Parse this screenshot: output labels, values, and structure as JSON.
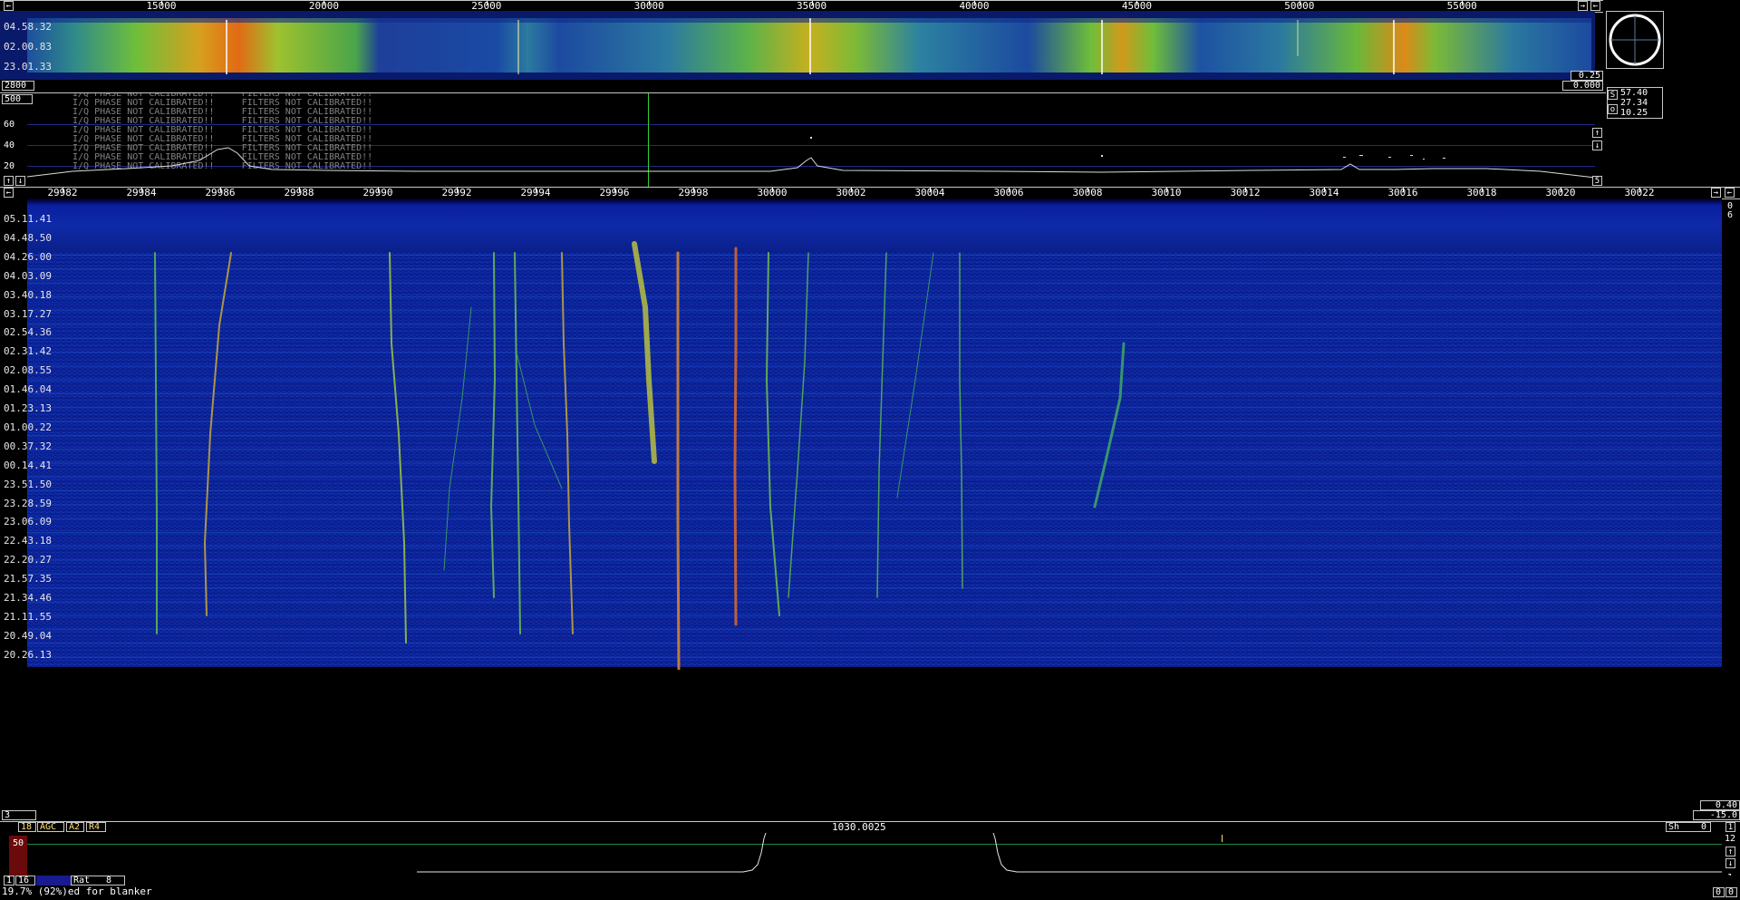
{
  "wide_scale": {
    "labels": [
      "15000",
      "20000",
      "25000",
      "30000",
      "35000",
      "40000",
      "45000",
      "50000",
      "55000"
    ],
    "left_arrow": "←",
    "right_arrow": "→",
    "right_arrow2": "←"
  },
  "wide_waterfall": {
    "time_labels": [
      "04.58.32",
      "02.00.83",
      "23.01.33"
    ],
    "left_value": "2800",
    "right_value_top": "0.25",
    "right_value_bottom": "0.000"
  },
  "spectrum": {
    "top_left_value": "500",
    "db_labels": [
      "60",
      "40",
      "20"
    ],
    "warning_rows": [
      "I/Q PHASE NOT CALIBRATED!!     FILTERS NOT CALIBRATED!!",
      "I/Q PHASE NOT CALIBRATED!!     FILTERS NOT CALIBRATED!!",
      "I/Q PHASE NOT CALIBRATED!!     FILTERS NOT CALIBRATED!!",
      "I/Q PHASE NOT CALIBRATED!!     FILTERS NOT CALIBRATED!!",
      "I/Q PHASE NOT CALIBRATED!!     FILTERS NOT CALIBRATED!!",
      "I/Q PHASE NOT CALIBRATED!!     FILTERS NOT CALIBRATED!!",
      "I/Q PHASE NOT CALIBRATED!!     FILTERS NOT CALIBRATED!!",
      "I/Q PHASE NOT CALIBRATED!!     FILTERS NOT CALIBRATED!!",
      "I/Q PHASE NOT CALIBRATED!!     FILTERS NOT CALIBRATED!!"
    ],
    "btn_up": "↑",
    "btn_down": "↓",
    "btn_five": "5"
  },
  "meter": {
    "readout1": "57.40",
    "readout2": "27.34",
    "readout3": "10.25",
    "key1": "S",
    "key2": "o"
  },
  "main_scale": {
    "labels": [
      "29982",
      "29984",
      "29986",
      "29988",
      "29990",
      "29992",
      "29994",
      "29996",
      "29998",
      "30000",
      "30002",
      "30004",
      "30006",
      "30008",
      "30010",
      "30012",
      "30014",
      "30016",
      "30018",
      "30020",
      "30022"
    ],
    "left_arrow": "←",
    "right_arrow": "→",
    "right_arrow2": "←",
    "side_values": [
      "0",
      "6"
    ]
  },
  "main_waterfall": {
    "time_labels": [
      "05.11.41",
      "04.48.50",
      "04.26.00",
      "04.03.09",
      "03.40.18",
      "03.17.27",
      "02.54.36",
      "02.31.42",
      "02.08.55",
      "01.46.04",
      "01.23.13",
      "01.00.22",
      "00.37.32",
      "00.14.41",
      "23.51.50",
      "23.28.59",
      "23.06.09",
      "22.43.18",
      "22.20.27",
      "21.57.35",
      "21.34.46",
      "21.11.55",
      "20.49.04",
      "20.26.13"
    ]
  },
  "bottom_bar": {
    "left_value": "3",
    "right_value_top": "0.40",
    "right_value_bottom": "-15.0"
  },
  "baseband": {
    "num18": "18",
    "agc": "AGC",
    "a2": "A2",
    "r4": "R4",
    "frequency": "1030.0025",
    "sh_label": "Sh",
    "sh_value": "0",
    "right_num": "1",
    "right_num2": "12",
    "level": "50",
    "btn_up": "↑",
    "btn_down": "↓",
    "bottom_right": "1"
  },
  "status": {
    "b1": "1",
    "b16": "16",
    "rat_label": "Rat",
    "rat_value": "8",
    "cpu_text": "19.7% (92%)ed for blanker",
    "right_zero1": "0",
    "right_zero2": "0"
  }
}
